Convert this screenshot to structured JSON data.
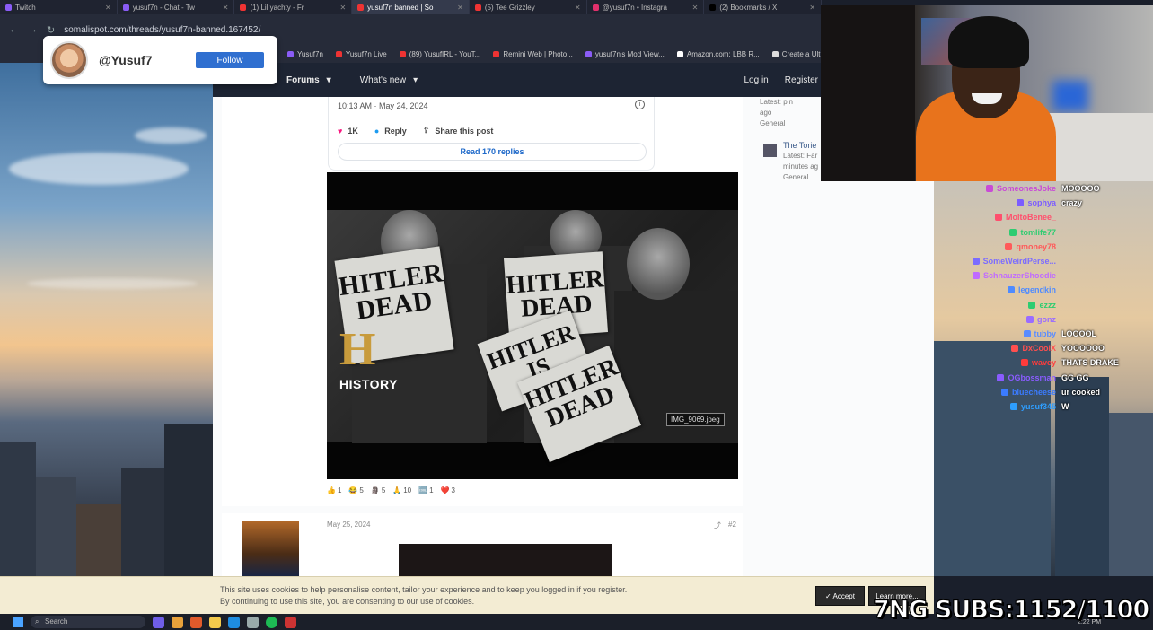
{
  "browser": {
    "tabs": [
      {
        "label": "Twitch",
        "icon": "twitch-icon"
      },
      {
        "label": "yusuf7n - Chat - Tw",
        "icon": "twitch-icon"
      },
      {
        "label": "(1) Lil yachty - Fr",
        "icon": "youtube-icon"
      },
      {
        "label": "yusuf7n banned | So",
        "icon": "forum-icon",
        "active": true
      },
      {
        "label": "(5) Tee Grizzley",
        "icon": "youtube-icon"
      },
      {
        "label": "@yusuf7n • Instagra",
        "icon": "instagram-icon"
      },
      {
        "label": "(2) Bookmarks / X",
        "icon": "x-icon"
      }
    ],
    "url": "somalispot.com/threads/yusuf7n-banned.167452/",
    "bookmarks": [
      "Yusuf7n",
      "Yusuf7n Live",
      "(89) YusufIRL - YouT...",
      "Remini Web | Photo...",
      "yusuf7n's Mod View...",
      "Amazon.com: LBB R...",
      "Create a Ultima"
    ]
  },
  "profile_card": {
    "handle": "@Yusuf7",
    "follow_label": "Follow"
  },
  "forum_nav": {
    "items": [
      "Forums",
      "What's new"
    ],
    "login": "Log in",
    "register": "Register"
  },
  "tweet": {
    "timestamp": "10:13 AM · May 24, 2024",
    "likes": "1K",
    "reply_label": "Reply",
    "share_label": "Share this post",
    "read_replies": "Read 170 replies"
  },
  "embedded_image": {
    "newspaper_text": "HITLER DEAD",
    "headlines": [
      {
        "line1": "HITLER",
        "line2": "DEAD"
      },
      {
        "line1": "HITLER",
        "line2": "DEAD"
      },
      {
        "line1": "HITLER",
        "line2": "IS"
      },
      {
        "line1": "HITLER",
        "line2": "DEAD"
      }
    ],
    "channel_logo": "H",
    "channel_name": "HISTORY",
    "filename": "IMG_9069.jpeg"
  },
  "reactions": [
    {
      "emoji": "👍",
      "count": "1"
    },
    {
      "emoji": "😂",
      "count": "5"
    },
    {
      "emoji": "🗿",
      "count": "5"
    },
    {
      "emoji": "🙏",
      "count": "10"
    },
    {
      "emoji": "🆒",
      "count": "1"
    },
    {
      "emoji": "❤️",
      "count": "3"
    }
  ],
  "second_post": {
    "date": "May 25, 2024",
    "number": "#2"
  },
  "sidebar": {
    "items": [
      {
        "title": "",
        "meta": "Latest: pin",
        "meta2": "ago",
        "forum": "General"
      },
      {
        "title": "The Torie",
        "meta": "Latest: Far",
        "meta2": "minutes ag",
        "forum": "General"
      }
    ]
  },
  "chat": [
    {
      "user": "SomeonesJoke",
      "color": "#c94bd6",
      "text": "MOOOOO"
    },
    {
      "user": "sophya",
      "color": "#7b5cff",
      "text": "crazy"
    },
    {
      "user": "MoltoBenee_",
      "color": "#ff4f6d",
      "text": ""
    },
    {
      "user": "tomlife77",
      "color": "#2ecc71",
      "text": ""
    },
    {
      "user": "qmoney78",
      "color": "#ff5a5a",
      "text": ""
    },
    {
      "user": "SomeWeirdPerse...",
      "color": "#7b6cff",
      "text": ""
    },
    {
      "user": "SchnauzerShoodie",
      "color": "#c06bff",
      "text": ""
    },
    {
      "user": "legendkin",
      "color": "#4f8bff",
      "text": ""
    },
    {
      "user": "ezzz",
      "color": "#2ecc71",
      "text": ""
    },
    {
      "user": "gonz",
      "color": "#9a6cff",
      "text": ""
    },
    {
      "user": "tubby",
      "color": "#5a8cff",
      "text": "LOOOOL"
    },
    {
      "user": "DxCoolX",
      "color": "#ff4f4f",
      "text": "YOOOOOO"
    },
    {
      "user": "wavey",
      "color": "#ff3b3b",
      "text": "THATS DRAKE"
    },
    {
      "user": "OGbossman",
      "color": "#8a5cff",
      "text": "GG GG"
    },
    {
      "user": "bluecheese",
      "color": "#3b7bff",
      "text": "ur cooked"
    },
    {
      "user": "yusuf345",
      "color": "#2e9eff",
      "text": "W"
    }
  ],
  "cookie_notice": {
    "line1": "This site uses cookies to help personalise content, tailor your experience and to keep you logged in if you register.",
    "line2": "By continuing to use this site, you are consenting to our use of cookies.",
    "accept": "Accept",
    "learn_more": "Learn more..."
  },
  "taskbar": {
    "search_placeholder": "Search",
    "time": "2:22 PM"
  },
  "overlay": {
    "subs": "7NG SUBS:1152/1100"
  }
}
